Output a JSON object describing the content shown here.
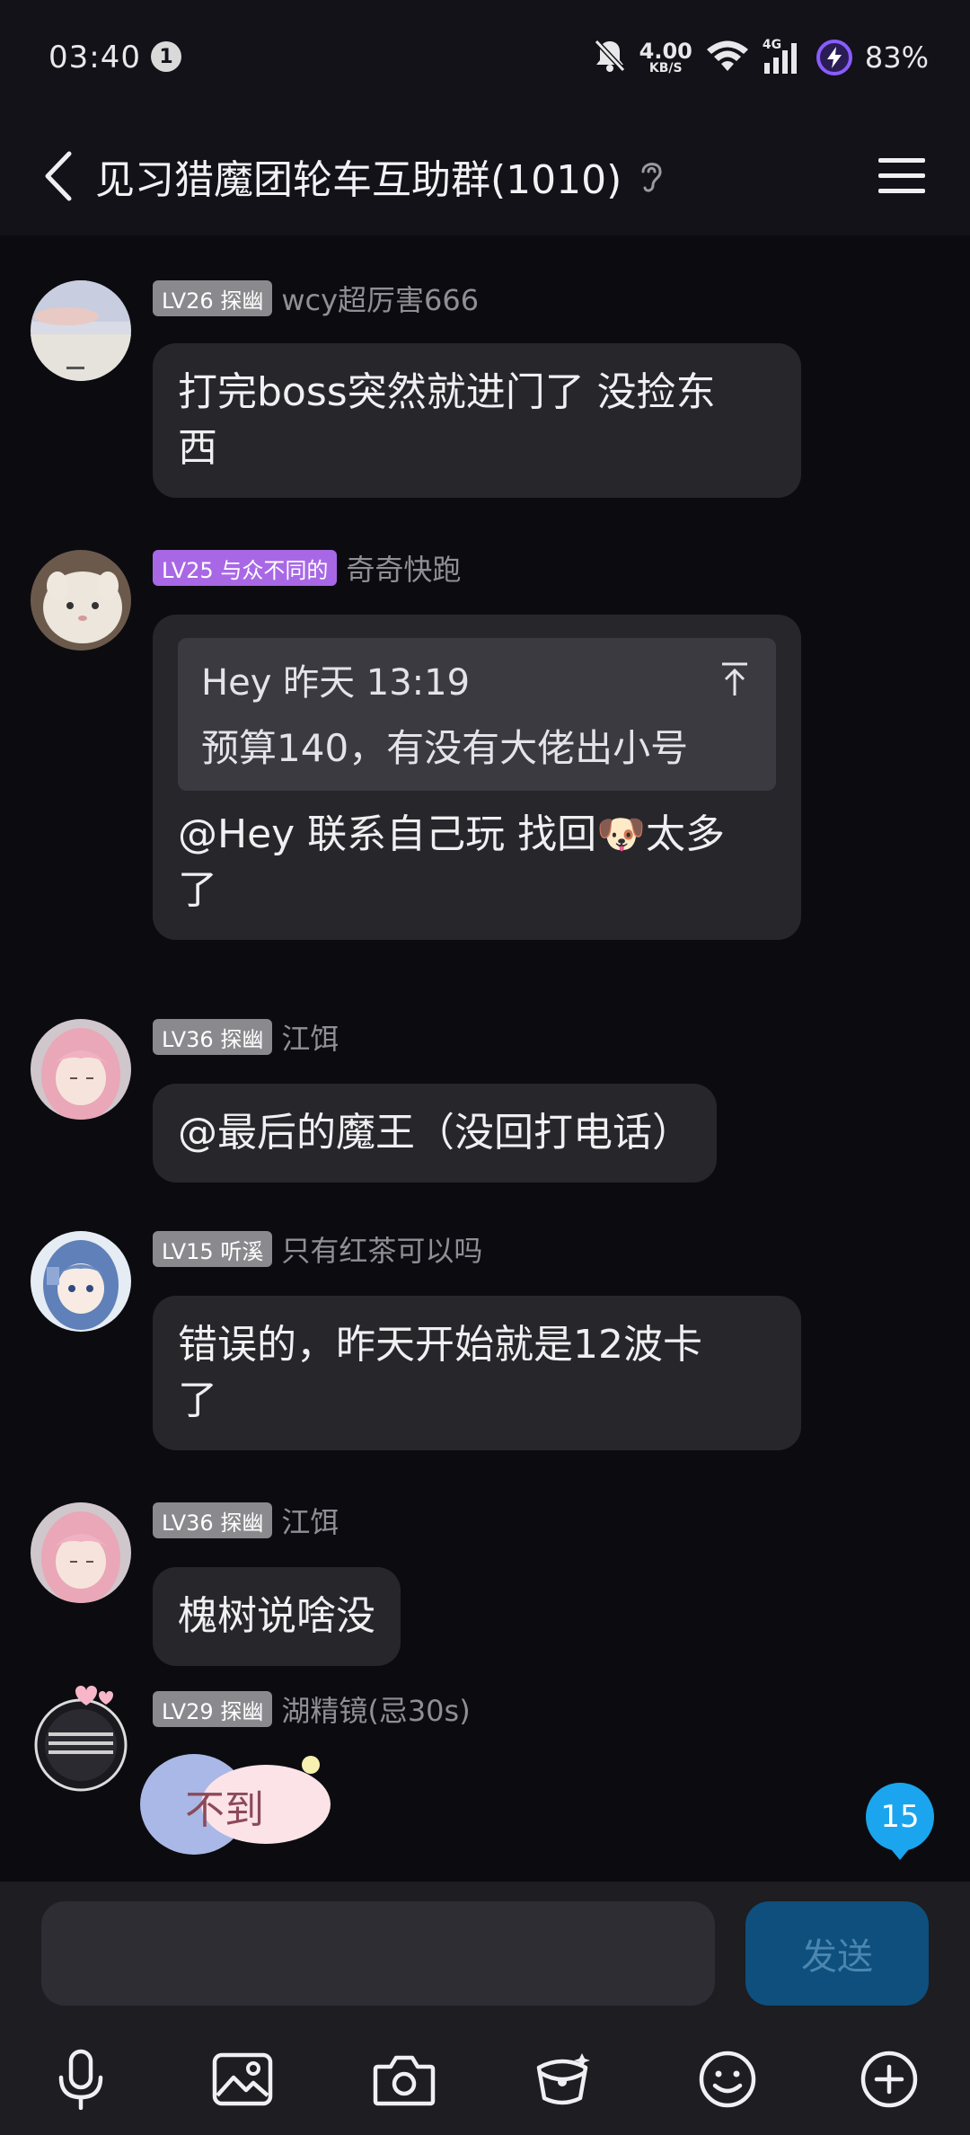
{
  "status_bar": {
    "time": "03:40",
    "notification_count": "1",
    "net_speed_value": "4.00",
    "net_speed_unit": "KB/S",
    "network_type": "4G",
    "battery_percent": "83%"
  },
  "header": {
    "title": "见习猎魔团轮车互助群(1010)"
  },
  "messages": [
    {
      "level": "LV26 探幽",
      "username": "wcy超厉害666",
      "text_lines": [
        "打完boss突然就进门了 没捡东",
        "西"
      ]
    },
    {
      "level": "LV25 与众不同的",
      "username": "奇奇快跑",
      "quote": {
        "author_time": "Hey 昨天 13:19",
        "text": "预算140，有没有大佬出小号"
      },
      "text_part1": "@Hey 联系自己玩 找回",
      "emoji": "🐶",
      "text_part2": "太多",
      "text_line2": "了"
    },
    {
      "level": "LV36 探幽",
      "username": "江饵",
      "text": "@最后的魔王（没回打电话）"
    },
    {
      "level": "LV15 听溪",
      "username": "只有红茶可以吗",
      "text_lines": [
        "错误的，昨天开始就是12波卡",
        "了"
      ]
    },
    {
      "level": "LV36 探幽",
      "username": "江饵",
      "text": "槐树说啥没"
    },
    {
      "level": "LV29 探幽",
      "username": "湖精镜(忌30s)",
      "sticker_text": "不到"
    }
  ],
  "unread_count": "15",
  "input": {
    "placeholder": "",
    "send_label": "发送"
  },
  "colors": {
    "background": "#0c0c10",
    "bubble": "#26262b",
    "badge_gray": "#8a8a8e",
    "badge_purple": "#a868e6",
    "accent_blue": "#1aa5ee",
    "send_button": "#0e4f7d"
  },
  "toolbar_icons": [
    "microphone-icon",
    "image-icon",
    "camera-icon",
    "red-packet-icon",
    "emoji-icon",
    "plus-icon"
  ]
}
